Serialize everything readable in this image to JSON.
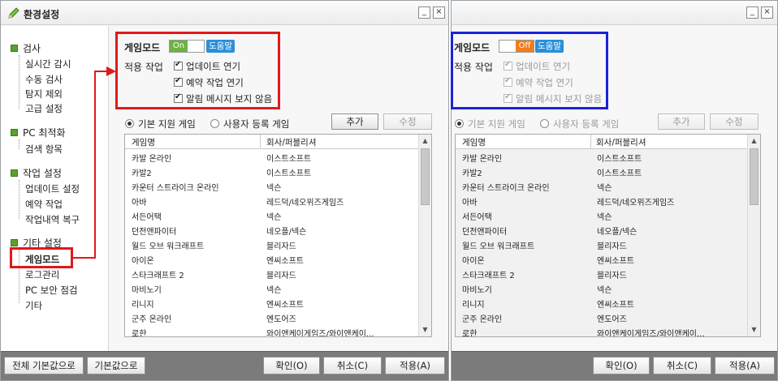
{
  "window": {
    "title": "환경설정",
    "minimize_label": "_",
    "close_label": "×"
  },
  "sidebar": {
    "categories": [
      {
        "label": "검사",
        "items": [
          "실시간 감시",
          "수동 검사",
          "탐지 제외",
          "고급 설정"
        ]
      },
      {
        "label": "PC 최적화",
        "items": [
          "검색 항목"
        ]
      },
      {
        "label": "작업 설정",
        "items": [
          "업데이트 설정",
          "예약 작업",
          "작업내역 복구"
        ]
      },
      {
        "label": "기타 설정",
        "items": [
          "게임모드",
          "로그관리",
          "PC 보안 점검",
          "기타"
        ]
      }
    ]
  },
  "gamemode": {
    "label": "게임모드",
    "toggle_on": "On",
    "toggle_off": "Off",
    "help": "도움말",
    "apply_label": "적용 작업",
    "options": [
      "업데이트 연기",
      "예약 작업 연기",
      "알림 메시지 보지 않음"
    ]
  },
  "list": {
    "radio_basic": "기본 지원 게임",
    "radio_user": "사용자 등록 게임",
    "add_button": "추가",
    "edit_button": "수정",
    "columns": [
      "게임명",
      "회사/퍼블리셔"
    ],
    "rows": [
      [
        "카발 온라인",
        "이스트소프트"
      ],
      [
        "카발2",
        "이스트소프트"
      ],
      [
        "카운터 스트라이크 온라인",
        "넥슨"
      ],
      [
        "아바",
        "레드덕/네오위즈게임즈"
      ],
      [
        "서든어택",
        "넥슨"
      ],
      [
        "던전앤파이터",
        "네오플/넥슨"
      ],
      [
        "월드 오브 워크래프트",
        "블리자드"
      ],
      [
        "아이온",
        "엔씨소프트"
      ],
      [
        "스타크래프트 2",
        "블리자드"
      ],
      [
        "마비노기",
        "넥슨"
      ],
      [
        "리니지",
        "엔씨소프트"
      ],
      [
        "군주 온라인",
        "엔도어즈"
      ],
      [
        "로한",
        "와이앤케이게임즈/와이앤케이..."
      ]
    ]
  },
  "bottom": {
    "reset_all": "전체 기본값으로",
    "reset": "기본값으로",
    "ok": "확인(O)",
    "cancel": "취소(C)",
    "apply": "적용(A)"
  },
  "colors": {
    "highlight_red": "#e0191b",
    "highlight_blue": "#1a23d6",
    "toggle_on": "#6cb33f",
    "toggle_off": "#f07c1a",
    "help": "#2b8fd9"
  }
}
